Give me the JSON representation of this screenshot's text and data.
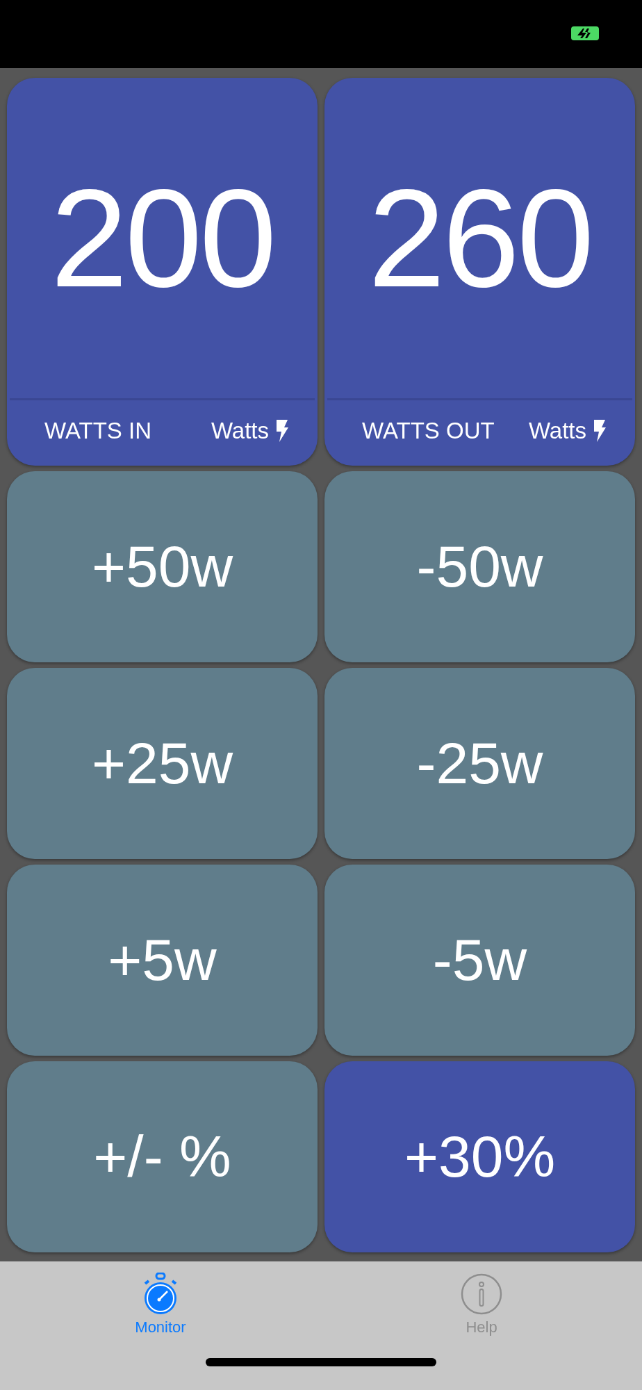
{
  "status_bar": {
    "battery_charging": true
  },
  "readouts": [
    {
      "value": "200",
      "label": "WATTS IN",
      "unit": "Watts"
    },
    {
      "value": "260",
      "label": "WATTS OUT",
      "unit": "Watts"
    }
  ],
  "buttons": [
    {
      "label": "+50w",
      "selected": false
    },
    {
      "label": "-50w",
      "selected": false
    },
    {
      "label": "+25w",
      "selected": false
    },
    {
      "label": "-25w",
      "selected": false
    },
    {
      "label": "+5w",
      "selected": false
    },
    {
      "label": "-5w",
      "selected": false
    },
    {
      "label": "+/- %",
      "selected": false
    },
    {
      "label": "+30%",
      "selected": true
    }
  ],
  "tabs": [
    {
      "label": "Monitor",
      "kind": "stopwatch",
      "selected": true
    },
    {
      "label": "Help",
      "kind": "info",
      "selected": false
    }
  ]
}
